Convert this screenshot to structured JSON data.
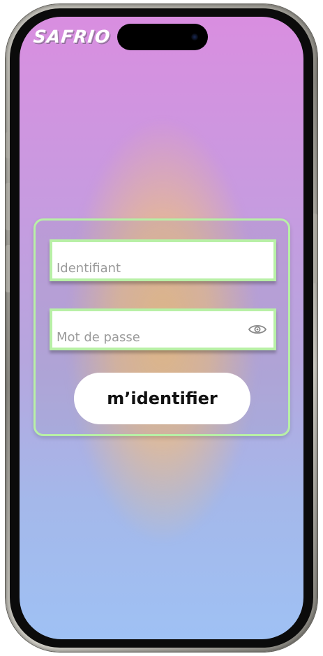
{
  "app": {
    "brand": "SAFRIO"
  },
  "login": {
    "username_placeholder": "Identifiant",
    "username_value": "",
    "password_placeholder": "Mot de passe",
    "password_value": "",
    "submit_label": "m’identifier"
  },
  "icons": {
    "password_toggle": "eye-icon",
    "camera": "camera-icon"
  },
  "colors": {
    "accent_border": "#b8f0a6",
    "background_top": "#d98ee0",
    "background_bottom": "#9fc1f4",
    "glow": "#f0be78"
  }
}
